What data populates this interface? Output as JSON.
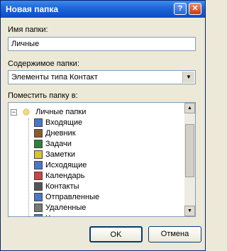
{
  "window": {
    "title": "Новая папка"
  },
  "titlebar": {
    "help_glyph": "?",
    "close_glyph": "✕"
  },
  "name": {
    "label": "Имя папки:",
    "value": "Личные"
  },
  "contents": {
    "label": "Содержимое папки:",
    "value": "Элементы типа Контакт"
  },
  "place": {
    "label": "Поместить папку в:"
  },
  "tree": {
    "root": "Личные папки",
    "items": [
      {
        "label": "Входящие",
        "icon": "inbox-icon",
        "color": "#4a77c9"
      },
      {
        "label": "Дневник",
        "icon": "journal-icon",
        "color": "#8b5a2b"
      },
      {
        "label": "Задачи",
        "icon": "tasks-icon",
        "color": "#2f7f3f"
      },
      {
        "label": "Заметки",
        "icon": "notes-icon",
        "color": "#d8c23a"
      },
      {
        "label": "Исходящие",
        "icon": "outbox-icon",
        "color": "#4a77c9"
      },
      {
        "label": "Календарь",
        "icon": "calendar-icon",
        "color": "#c44"
      },
      {
        "label": "Контакты",
        "icon": "contacts-icon",
        "color": "#555"
      },
      {
        "label": "Отправленные",
        "icon": "sent-icon",
        "color": "#4a77c9"
      },
      {
        "label": "Удаленные",
        "icon": "trash-icon",
        "color": "#777"
      },
      {
        "label": "Черновики",
        "icon": "drafts-icon",
        "color": "#4a77c9"
      }
    ]
  },
  "buttons": {
    "ok": "OK",
    "cancel": "Отмена"
  }
}
